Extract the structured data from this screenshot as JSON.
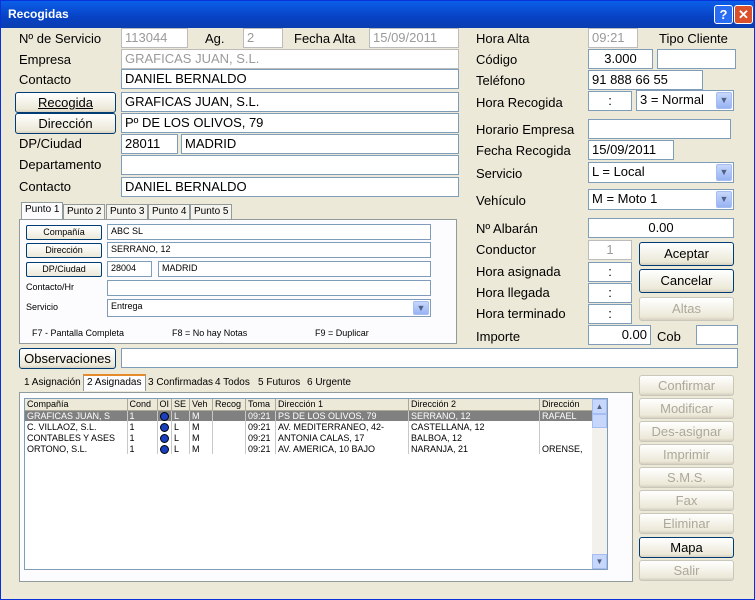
{
  "window": {
    "title": "Recogidas",
    "help": "?",
    "close": "✕"
  },
  "form": {
    "servicio_label": "Nº de Servicio",
    "servicio": "113044",
    "ag_label": "Ag.",
    "ag": "2",
    "fecha_alta_label": "Fecha Alta",
    "fecha_alta": "15/09/2011",
    "empresa_label": "Empresa",
    "empresa": "GRAFICAS JUAN, S.L.",
    "contacto_label": "Contacto",
    "contacto": "DANIEL BERNALDO",
    "recogida_button": "Recogida",
    "recogida": "GRAFICAS JUAN, S.L.",
    "direccion_button": "Dirección",
    "direccion": "Pº DE LOS OLIVOS, 79",
    "dp_label": "DP/Ciudad",
    "dp": "28011",
    "ciudad": "MADRID",
    "departamento_label": "Departamento",
    "departamento": "",
    "contacto2_label": "Contacto",
    "contacto2": "DANIEL BERNALDO",
    "hora_alta_label": "Hora Alta",
    "hora_alta": "09:21",
    "tipo_cliente_label": "Tipo Cliente",
    "codigo_label": "Código",
    "codigo": "3.000",
    "codigo2": "",
    "telefono_label": "Teléfono",
    "telefono": "91 888 66 55",
    "hora_recogida_label": "Hora Recogida",
    "hora_recogida": ":",
    "hora_recogida_option": "3 = Normal",
    "horario_empresa_label": "Horario Empresa",
    "horario_empresa": "",
    "fecha_recogida_label": "Fecha Recogida",
    "fecha_recogida": "15/09/2011",
    "servicio2_label": "Servicio",
    "servicio2": "L = Local",
    "vehiculo_label": "Vehículo",
    "vehiculo": "M = Moto 1",
    "albaran_label": "Nº Albarán",
    "albaran": "0.00",
    "conductor_label": "Conductor",
    "conductor": "1",
    "hora_asignada_label": "Hora asignada",
    "hora_asignada": ":",
    "hora_llegada_label": "Hora llegada",
    "hora_llegada": ":",
    "hora_terminado_label": "Hora terminado",
    "hora_terminado": ":",
    "importe_label": "Importe",
    "importe": "0.00",
    "cob_label": "Cob",
    "cob": "",
    "observaciones_button": "Observaciones",
    "observaciones": ""
  },
  "buttons": {
    "aceptar": "Aceptar",
    "cancelar": "Cancelar",
    "altas": "Altas",
    "confirmar": "Confirmar",
    "modificar": "Modificar",
    "desasignar": "Des-asignar",
    "imprimir": "Imprimir",
    "sms": "S.M.S.",
    "fax": "Fax",
    "eliminar": "Eliminar",
    "mapa": "Mapa",
    "salir": "Salir"
  },
  "punto_tabs": [
    "Punto 1",
    "Punto 2",
    "Punto 3",
    "Punto 4",
    "Punto 5"
  ],
  "punto": {
    "compania_button": "Compañía",
    "compania": "ABC SL",
    "direccion_button": "Dirección",
    "direccion": "SERRANO, 12",
    "dp_button": "DP/Ciudad",
    "dp": "28004",
    "ciudad": "MADRID",
    "contacto_label": "Contacto/Hr",
    "contacto": "",
    "servicio_label": "Servicio",
    "servicio": "Entrega",
    "f7": "F7 - Pantalla Completa",
    "f8": "F8 = No hay Notas",
    "f9": "F9 = Duplicar"
  },
  "bottom_tabs": [
    "1 Asignación",
    "2 Asignadas",
    "3 Confirmadas",
    "4 Todos",
    "5 Futuros",
    "6 Urgente"
  ],
  "table": {
    "headers": [
      "Compañía",
      "Cond",
      "OI",
      "SE",
      "Veh",
      "Recog",
      "Toma",
      "Dirección 1",
      "Dirección 2",
      "Dirección"
    ],
    "rows": [
      [
        "GRAFICAS JUAN, S",
        "1",
        "",
        "L",
        "M",
        "",
        "09:21",
        "PS DE LOS OLIVOS, 79",
        "SERRANO, 12",
        "RAFAEL"
      ],
      [
        "C. VILLAOZ, S.L.",
        "1",
        "",
        "L",
        "M",
        "",
        "09:21",
        "AV. MEDITERRANEO, 42-",
        "CASTELLANA, 12",
        ""
      ],
      [
        "CONTABLES Y ASES",
        "1",
        "",
        "L",
        "M",
        "",
        "09:21",
        "ANTONIA CALAS, 17",
        "BALBOA, 12",
        ""
      ],
      [
        "ORTONO, S.L.",
        "1",
        "",
        "L",
        "M",
        "",
        "09:21",
        "AV. AMERICA, 10 BAJO",
        "NARANJA, 21",
        "ORENSE,"
      ]
    ]
  }
}
